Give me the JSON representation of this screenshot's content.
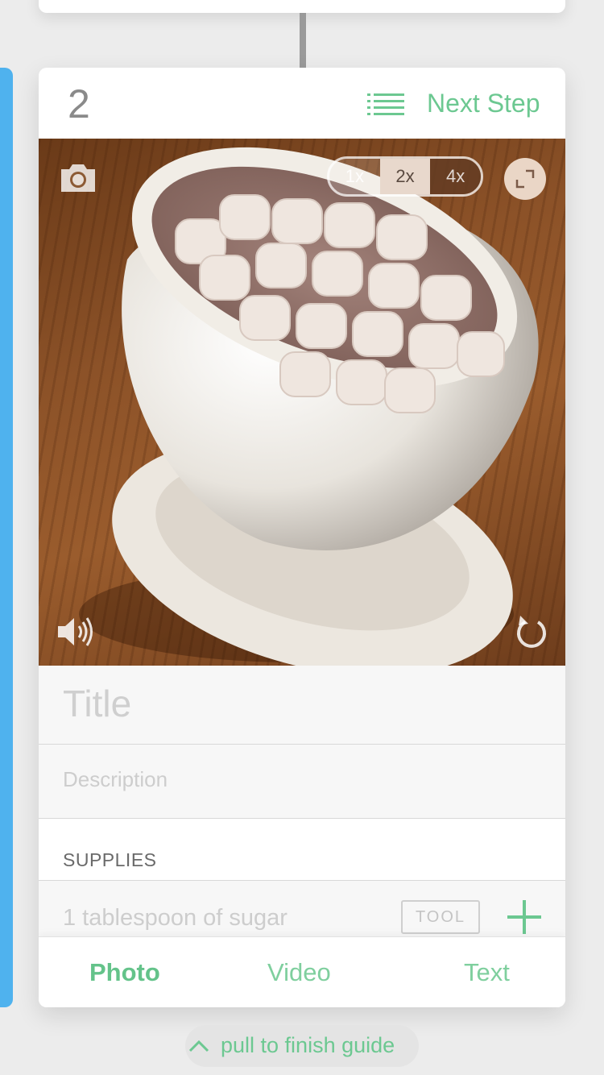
{
  "step": {
    "number": "2",
    "next_step_label": "Next Step",
    "menu_icon": "list-icon"
  },
  "media": {
    "camera_icon": "camera-icon",
    "zoom_options": [
      "1x",
      "2x",
      "4x"
    ],
    "zoom_selected": "2x",
    "expand_icon": "expand-icon",
    "sound_icon": "speaker-icon",
    "replay_icon": "replay-icon"
  },
  "fields": {
    "title_placeholder": "Title",
    "description_placeholder": "Description"
  },
  "supplies": {
    "heading": "SUPPLIES",
    "item_placeholder": "1 tablespoon of sugar",
    "tool_label": "TOOL",
    "add_icon": "plus-icon"
  },
  "tabs": {
    "photo": "Photo",
    "video": "Video",
    "text": "Text",
    "active": "Photo"
  },
  "footer": {
    "pull_hint": "pull to finish guide"
  },
  "colors": {
    "accent": "#6cc891",
    "side_tab": "#4fb2ee",
    "background": "#ececec"
  }
}
